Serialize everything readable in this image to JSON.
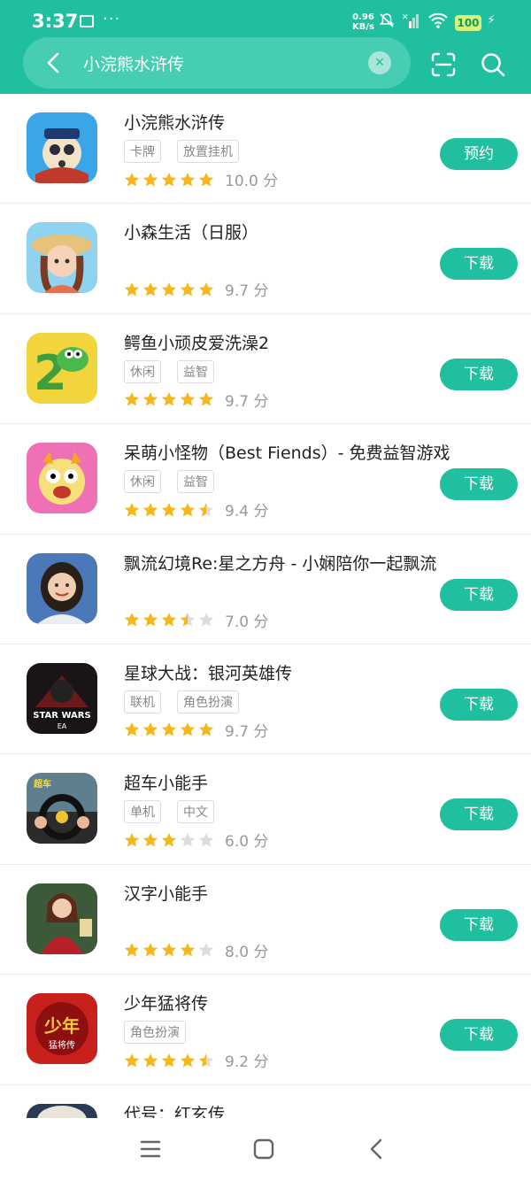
{
  "status": {
    "time": "3:37",
    "speed_value": "0.96",
    "speed_unit": "KB/s",
    "battery": "100"
  },
  "search": {
    "query": "小浣熊水浒传"
  },
  "colors": {
    "accent": "#1fbf9f",
    "star": "#f5b81c",
    "star_empty": "#dddddd"
  },
  "apps": [
    {
      "name": "小浣熊水浒传",
      "tags": [
        "卡牌",
        "放置挂机"
      ],
      "rating": 10.0,
      "score": "10.0 分",
      "button": "预约",
      "icon": "raccoon-hero-icon"
    },
    {
      "name": "小森生活（日服）",
      "tags": [],
      "rating": 9.7,
      "score": "9.7 分",
      "button": "下载",
      "icon": "girl-straw-hat-icon"
    },
    {
      "name": "鳄鱼小顽皮爱洗澡2",
      "tags": [
        "休闲",
        "益智"
      ],
      "rating": 9.7,
      "score": "9.7 分",
      "button": "下载",
      "icon": "crocodile-icon"
    },
    {
      "name": "呆萌小怪物（Best Fiends）- 免费益智游戏",
      "tags": [
        "休闲",
        "益智"
      ],
      "rating": 9.4,
      "score": "9.4 分",
      "button": "下载",
      "icon": "pink-monster-icon"
    },
    {
      "name": "飘流幻境Re:星之方舟 - 小娴陪你一起飘流",
      "tags": [],
      "rating": 7.0,
      "score": "7.0 分",
      "button": "下载",
      "icon": "woman-portrait-icon"
    },
    {
      "name": "星球大战：银河英雄传",
      "tags": [
        "联机",
        "角色扮演"
      ],
      "rating": 9.7,
      "score": "9.7 分",
      "button": "下载",
      "icon": "star-wars-icon"
    },
    {
      "name": "超车小能手",
      "tags": [
        "单机",
        "中文"
      ],
      "rating": 6.0,
      "score": "6.0 分",
      "button": "下载",
      "icon": "steering-wheel-icon"
    },
    {
      "name": "汉字小能手",
      "tags": [],
      "rating": 8.0,
      "score": "8.0 分",
      "button": "下载",
      "icon": "woman-red-dress-icon"
    },
    {
      "name": "少年猛将传",
      "tags": [
        "角色扮演"
      ],
      "rating": 9.2,
      "score": "9.2 分",
      "button": "下载",
      "icon": "warrior-logo-icon"
    },
    {
      "name": "代号：红玄传",
      "tags": [],
      "rating": null,
      "score": "",
      "button": "",
      "icon": "partial-icon"
    }
  ]
}
